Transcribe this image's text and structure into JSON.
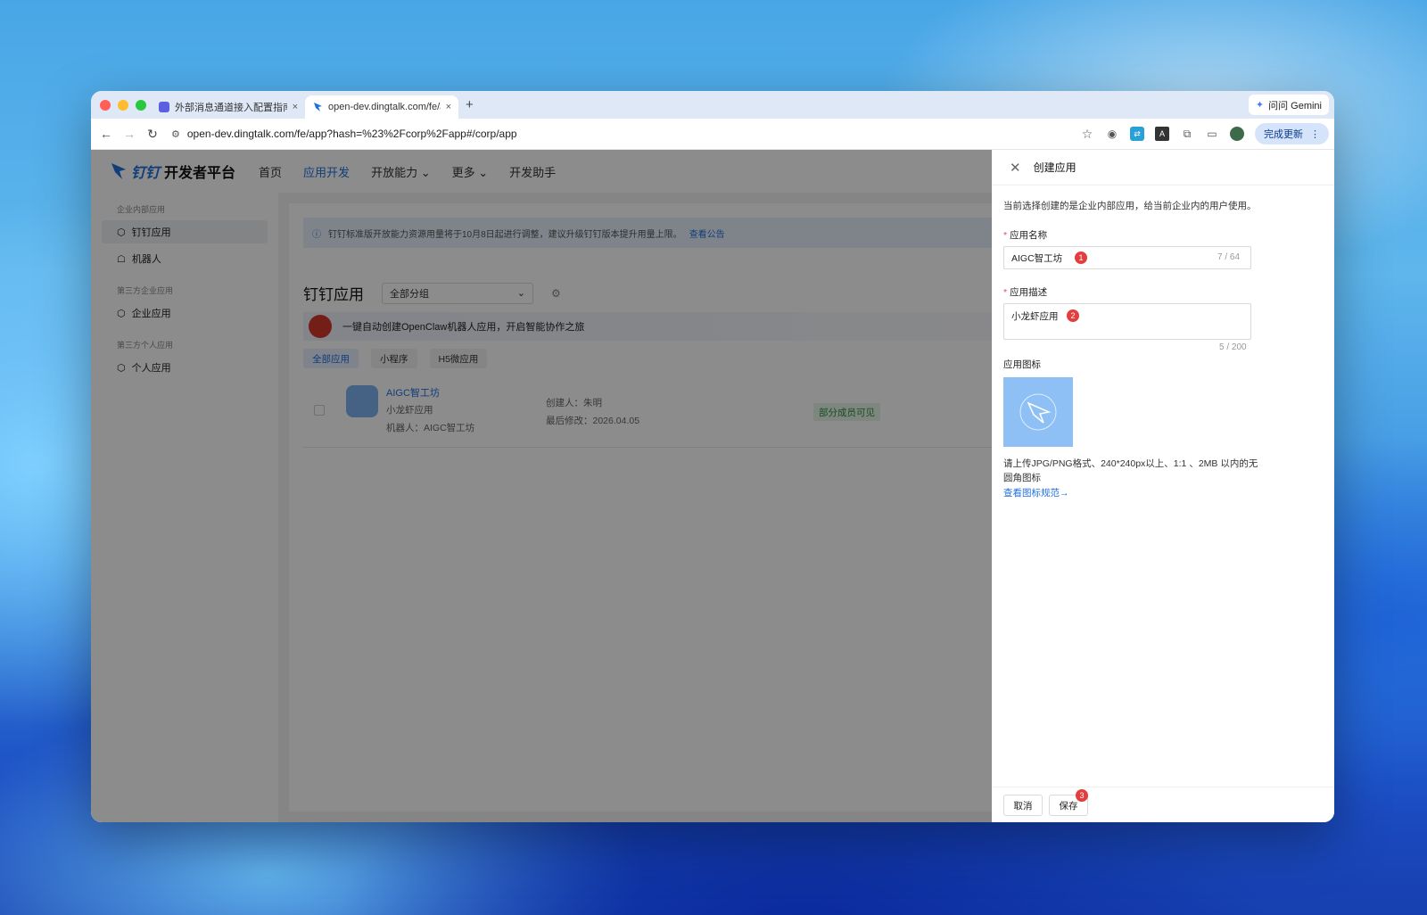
{
  "browser": {
    "tabs": [
      {
        "title": "外部消息通道接入配置指南",
        "close": "×"
      },
      {
        "title": "open-dev.dingtalk.com/fe/app",
        "close": "×"
      }
    ],
    "newtab": "+",
    "gemini": "问问 Gemini",
    "url": "open-dev.dingtalk.com/fe/app?hash=%23%2Fcorp%2Fapp#/corp/app",
    "update": "完成更新"
  },
  "header": {
    "logo_brand": "钉钉",
    "logo_text": "开发者平台",
    "nav": [
      "首页",
      "应用开发",
      "开放能力",
      "更多",
      "开发助手"
    ]
  },
  "sidebar": {
    "sec1": "企业内部应用",
    "item1": "钉钉应用",
    "item2": "机器人",
    "sec2": "第三方企业应用",
    "item3": "企业应用",
    "sec3": "第三方个人应用",
    "item4": "个人应用"
  },
  "main": {
    "banner": "钉钉标准版开放能力资源用量将于10月8日起进行调整，建议升级钉钉版本提升用量上限。",
    "banner_link": "查看公告",
    "title": "钉钉应用",
    "group_select": "全部分组",
    "promo": "一键自动创建OpenClaw机器人应用，开启智能协作之旅",
    "filters": [
      "全部应用",
      "小程序",
      "H5微应用"
    ],
    "app": {
      "name": "AIGC智工坊",
      "desc": "小龙虾应用",
      "robot": "机器人：AIGC智工坊",
      "creator": "创建人：朱明",
      "modified": "最后修改：2026.04.05",
      "visibility": "部分成员可见"
    }
  },
  "drawer": {
    "title": "创建应用",
    "note": "当前选择创建的是企业内部应用，给当前企业内的用户使用。",
    "name_label": "应用名称",
    "name_value": "AIGC智工坊",
    "name_count": "7 / 64",
    "desc_label": "应用描述",
    "desc_value": "小龙虾应用",
    "desc_count": "5 / 200",
    "icon_label": "应用图标",
    "icon_hint": "请上传JPG/PNG格式、240*240px以上、1:1 、2MB 以内的无圆角图标",
    "icon_link": "查看图标规范→",
    "cancel": "取消",
    "save": "保存",
    "badges": [
      "1",
      "2",
      "3"
    ]
  }
}
